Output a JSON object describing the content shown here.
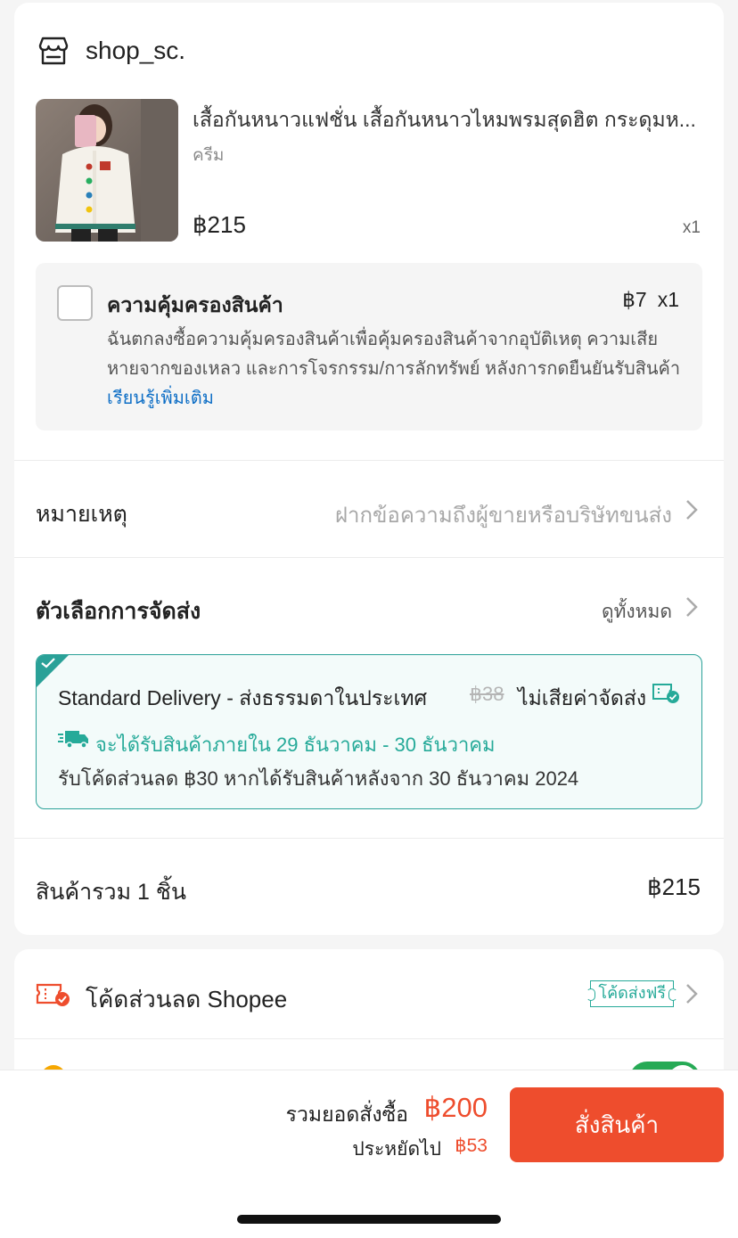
{
  "shop": {
    "name": "shop_sc."
  },
  "product": {
    "name": "เสื้อกันหนาวแฟชั่น เสื้อกันหนาวไหมพรมสุดฮิต กระดุมห...",
    "variant": "ครีม",
    "price": "฿215",
    "quantity": "x1"
  },
  "protection": {
    "title": "ความคุ้มครองสินค้า",
    "price": "฿7",
    "quantity": "x1",
    "description": "ฉันตกลงซื้อความคุ้มครองสินค้าเพื่อคุ้มครองสินค้าจากอุบัติเหตุ ความเสียหายจากของเหลว และการโจรกรรม/การลักทรัพย์ หลังการกดยืนยันรับสินค้า ",
    "learn_more": "เรียนรู้เพิ่มเติม",
    "checked": false
  },
  "note": {
    "label": "หมายเหตุ",
    "placeholder": "ฝากข้อความถึงผู้ขายหรือบริษัทขนส่ง"
  },
  "shipping": {
    "title": "ตัวเลือกการจัดส่ง",
    "view_all": "ดูทั้งหมด",
    "option": {
      "name": "Standard Delivery - ส่งธรรมดาในประเทศ",
      "old_price": "฿38",
      "free_label": "ไม่เสียค่าจัดส่ง",
      "eta": "จะได้รับสินค้าภายใน 29 ธันวาคม - 30 ธันวาคม",
      "promo": "รับโค้ดส่วนลด ฿30 หากได้รับสินค้าหลังจาก 30 ธันวาคม 2024",
      "accent": "#26aa99"
    }
  },
  "subtotal": {
    "label": "สินค้ารวม 1 ชิ้น",
    "value": "฿215"
  },
  "voucher": {
    "label": "โค้ดส่วนลด Shopee",
    "tag": "โค้ดส่งฟรี"
  },
  "coins": {
    "enabled": true
  },
  "footer": {
    "total_label": "รวมยอดสั่งซื้อ",
    "total_value": "฿200",
    "saved_label": "ประหยัดไป",
    "saved_value": "฿53",
    "order_button": "สั่งสินค้า",
    "accent": "#ee4d2d"
  }
}
